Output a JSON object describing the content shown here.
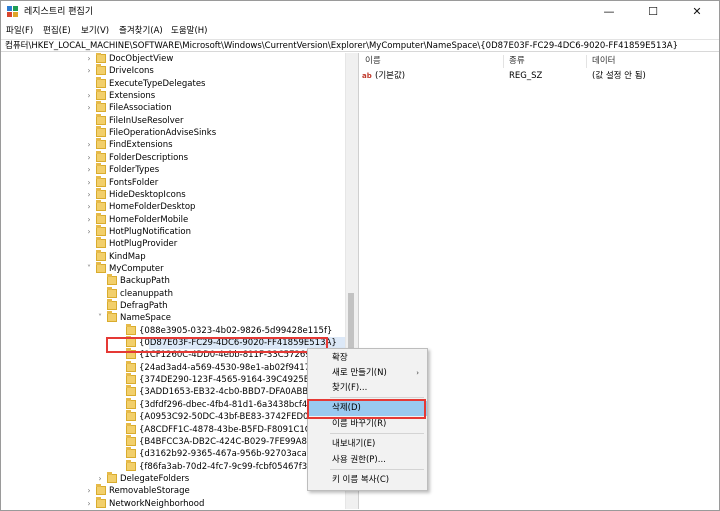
{
  "window": {
    "title": "레지스트리 편집기",
    "controls": {
      "minimize": "—",
      "maximize": "☐",
      "close": "✕"
    }
  },
  "menu": [
    "파일(F)",
    "편집(E)",
    "보기(V)",
    "즐겨찾기(A)",
    "도움말(H)"
  ],
  "address": "컴퓨터\\HKEY_LOCAL_MACHINE\\SOFTWARE\\Microsoft\\Windows\\CurrentVersion\\Explorer\\MyComputer\\NameSpace\\{0D87E03F-FC29-4DC6-9020-FF41859E513A}",
  "tree": [
    {
      "label": "DocObjectView",
      "expander": "›"
    },
    {
      "label": "DriveIcons",
      "expander": "›"
    },
    {
      "label": "ExecuteTypeDelegates",
      "expander": ""
    },
    {
      "label": "Extensions",
      "expander": "›"
    },
    {
      "label": "FileAssociation",
      "expander": "›"
    },
    {
      "label": "FileInUseResolver",
      "expander": ""
    },
    {
      "label": "FileOperationAdviseSinks",
      "expander": ""
    },
    {
      "label": "FindExtensions",
      "expander": "›"
    },
    {
      "label": "FolderDescriptions",
      "expander": "›"
    },
    {
      "label": "FolderTypes",
      "expander": "›"
    },
    {
      "label": "FontsFolder",
      "expander": "›"
    },
    {
      "label": "HideDesktopIcons",
      "expander": "›"
    },
    {
      "label": "HomeFolderDesktop",
      "expander": "›"
    },
    {
      "label": "HomeFolderMobile",
      "expander": "›"
    },
    {
      "label": "HotPlugNotification",
      "expander": "›"
    },
    {
      "label": "HotPlugProvider",
      "expander": ""
    },
    {
      "label": "KindMap",
      "expander": ""
    },
    {
      "label": "MyComputer",
      "expander": "˅"
    },
    {
      "label": "BackupPath",
      "expander": ""
    },
    {
      "label": "cleanuppath",
      "expander": ""
    },
    {
      "label": "DefragPath",
      "expander": ""
    },
    {
      "label": "NameSpace",
      "expander": "˅"
    },
    {
      "label": "{088e3905-0323-4b02-9826-5d99428e115f}",
      "expander": ""
    },
    {
      "label": "{0D87E03F-FC29-4DC6-9020-FF41859E513A}",
      "expander": ""
    },
    {
      "label": "{1CF1260C-4DD0-4ebb-811F-33C572699FDE}",
      "expander": ""
    },
    {
      "label": "{24ad3ad4-a569-4530-98e1-ab02f9417aa8}",
      "expander": ""
    },
    {
      "label": "{374DE290-123F-4565-9164-39C4925E467B}",
      "expander": ""
    },
    {
      "label": "{3ADD1653-EB32-4cb0-BBD7-DFA0ABB5ACCA}",
      "expander": ""
    },
    {
      "label": "{3dfdf296-dbec-4fb4-81d1-6a3438bcf4de}",
      "expander": ""
    },
    {
      "label": "{A0953C92-50DC-43bf-BE83-3742FED03C9C}",
      "expander": ""
    },
    {
      "label": "{A8CDFF1C-4878-43be-B5FD-F8091C1C60D0}",
      "expander": ""
    },
    {
      "label": "{B4BFCC3A-DB2C-424C-B029-7FE99A87C641}",
      "expander": ""
    },
    {
      "label": "{d3162b92-9365-467a-956b-92703aca08af}",
      "expander": ""
    },
    {
      "label": "{f86fa3ab-70d2-4fc7-9c99-fcbf05467f3a}",
      "expander": ""
    },
    {
      "label": "DelegateFolders",
      "expander": "›"
    },
    {
      "label": "RemovableStorage",
      "expander": "›"
    },
    {
      "label": "NetworkNeighborhood",
      "expander": "›"
    }
  ],
  "values_pane": {
    "columns": [
      "이름",
      "종류",
      "데이터"
    ],
    "rows": [
      {
        "icon": "ab",
        "name": "(기본값)",
        "type": "REG_SZ",
        "data": "(값 설정 안 됨)"
      }
    ]
  },
  "context_menu": {
    "items": [
      {
        "label": "확장",
        "arrow": ""
      },
      {
        "label": "새로 만들기(N)",
        "arrow": "›"
      },
      {
        "label": "찾기(F)...",
        "arrow": ""
      },
      {
        "label": "삭제(D)",
        "arrow": ""
      },
      {
        "label": "이름 바꾸기(R)",
        "arrow": ""
      },
      {
        "label": "내보내기(E)",
        "arrow": ""
      },
      {
        "label": "사용 권한(P)...",
        "arrow": ""
      },
      {
        "label": "키 이름 복사(C)",
        "arrow": ""
      }
    ]
  },
  "colors": {
    "highlight": "#e53935",
    "menu_selected": "#99c9ef",
    "folder": "#f2cf6b"
  }
}
